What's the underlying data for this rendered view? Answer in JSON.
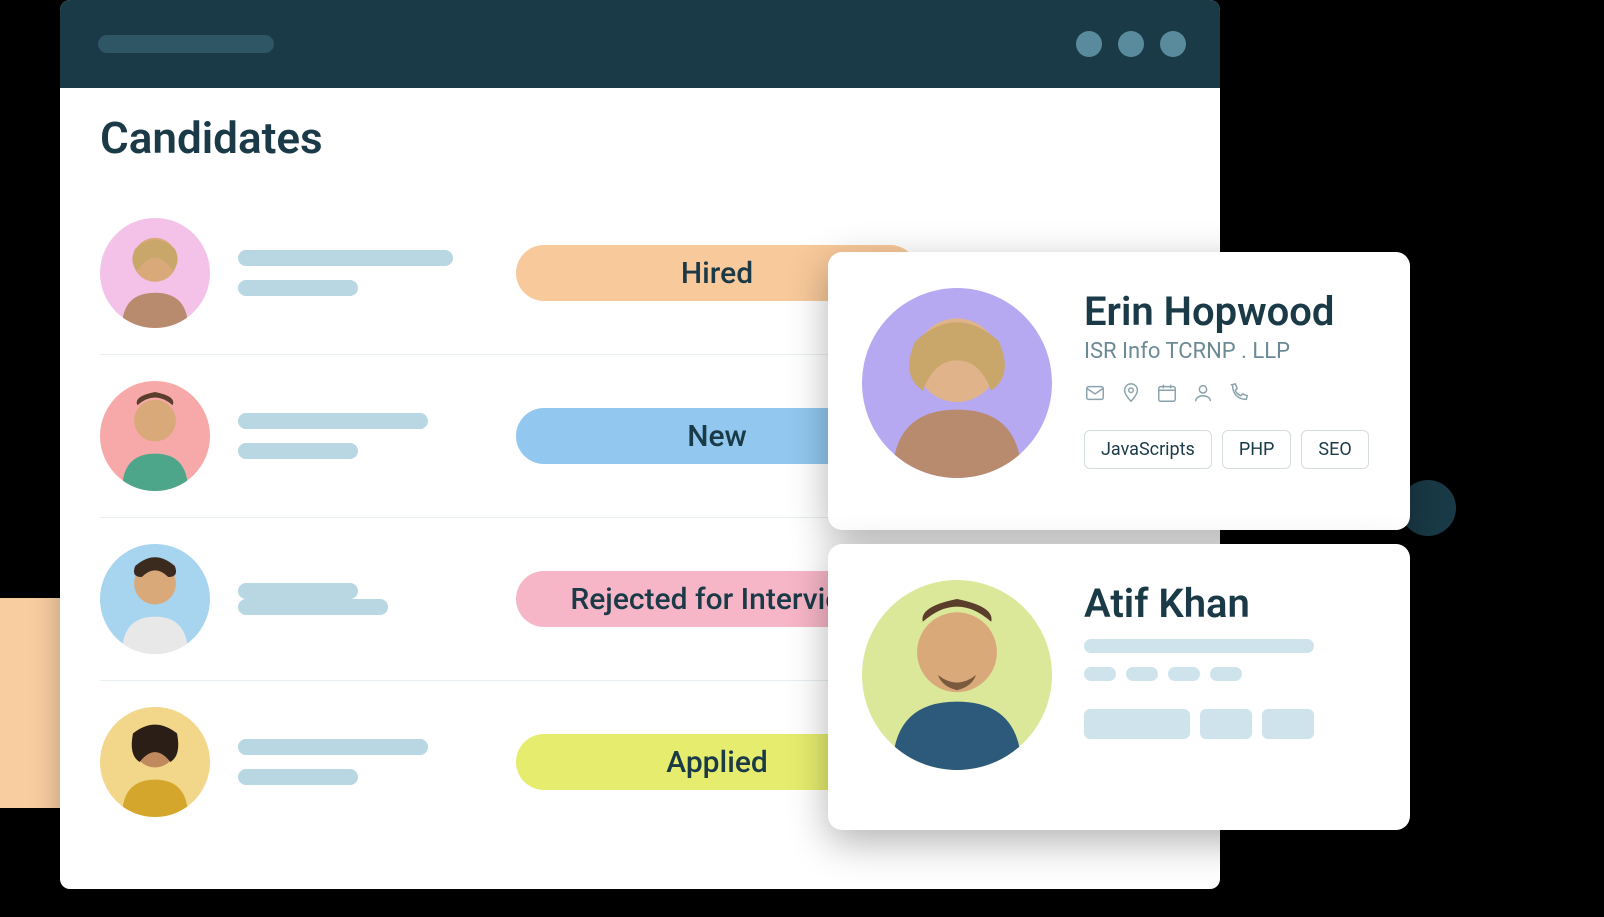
{
  "page": {
    "title": "Candidates"
  },
  "rows": [
    {
      "status": "Hired",
      "statusClass": "hired",
      "avatarBg": "#f4c2e8"
    },
    {
      "status": "New",
      "statusClass": "new",
      "avatarBg": "#f7a9a9"
    },
    {
      "status": "Rejected for Interview",
      "statusClass": "rejected",
      "avatarBg": "#a7d4ef"
    },
    {
      "status": "Applied",
      "statusClass": "applied",
      "avatarBg": "#f2d68a"
    }
  ],
  "card1": {
    "name": "Erin Hopwood",
    "subtitle": "ISR Info TCRNP . LLP",
    "tags": [
      "JavaScripts",
      "PHP",
      "SEO"
    ],
    "avatarBg": "#b6a9f2"
  },
  "card2": {
    "name": "Atif Khan",
    "avatarBg": "#dbe89a"
  }
}
